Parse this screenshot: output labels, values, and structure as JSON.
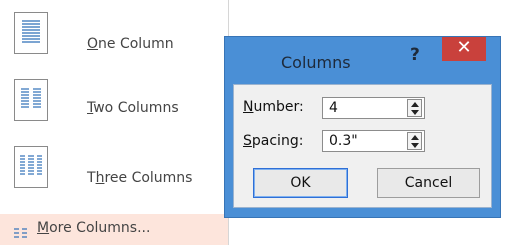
{
  "menu": {
    "items": [
      {
        "pre": "",
        "ul": "O",
        "post": "ne Column"
      },
      {
        "pre": "",
        "ul": "T",
        "post": "wo Columns"
      },
      {
        "pre": "T",
        "ul": "h",
        "post": "ree Columns"
      }
    ],
    "more": {
      "pre": "",
      "ul": "M",
      "post": "ore Columns..."
    }
  },
  "dialog": {
    "title": "Columns",
    "help": "?",
    "close": "✕",
    "number": {
      "ul": "N",
      "post": "umber:",
      "value": "4"
    },
    "spacing": {
      "ul": "S",
      "post": "pacing:",
      "value": "0.3\""
    },
    "ok": "OK",
    "cancel": "Cancel"
  },
  "colors": {
    "accent": "#4a8fd6",
    "close": "#c9413c",
    "hover": "#fde5dc"
  }
}
